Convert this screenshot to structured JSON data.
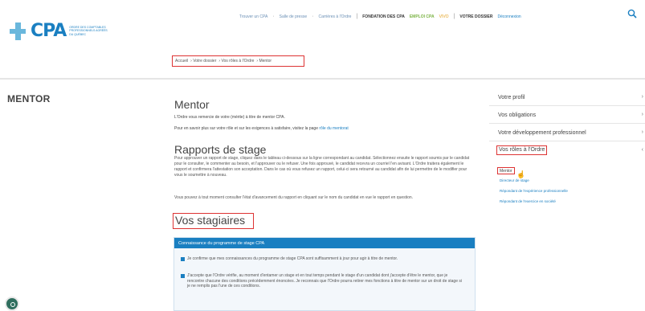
{
  "header": {
    "logo_text": "CPA",
    "logo_sub": "Ordre des comptables professionnels agréés du Québec",
    "nav": [
      "Trouver un CPA",
      "Salle de presse",
      "Carrières à l'Ordre"
    ],
    "foundation": "FONDATION DES CPA",
    "emploi": "EMPLOI CPA",
    "vivo": "VIVO",
    "dossier": "VOTRE DOSSIER",
    "deconnexion": "Déconnexion"
  },
  "breadcrumb": [
    "Accueil",
    "Votre dossier",
    "Vos rôles à l'Ordre",
    "Mentor"
  ],
  "side_title": "MENTOR",
  "main": {
    "title": "Mentor",
    "intro": "L'Ordre vous remercie de votre (mérite) à titre de mentor CPA.",
    "info_prefix": "Pour en savoir plus sur votre rôle et sur les exigences à satisfaire, visitez la page ",
    "info_link": "rôle du mentorat",
    "rapports_title": "Rapports de stage",
    "rapports_text": "Pour approuver un rapport de stage, cliquez dans le tableau ci-dessous sur la ligne correspondant au candidat. Sélectionnez ensuite le rapport soumis par le candidat pour le consulter, le commenter au besoin, et l'approuver ou le refuser. Une fois approuvé, le candidat recevra un courriel l'en avisant. L'Ordre traitera également le rapport et confirmera l'attestation son acceptation. Dans le cas où vous refusez un rapport, celui-ci sera retourné au candidat afin de lui permettre de le modifier pour vous le soumettre à nouveau.",
    "rapports_text2": "Vous pouvez à tout moment consulter l'état d'avancement du rapport en cliquant sur le nom du candidat en vue le rapport en question.",
    "stagiaires_title": "Vos stagiaires",
    "panel_title": "Connaissance du programme de stage CPA",
    "check1": "Je confirme que mes connaissances du programme de stage CPA sont suffisamment à jour pour agir à titre de mentor.",
    "check2": "J'accepte que l'Ordre vérifie, au moment d'entamer un stage et en tout temps pendant le stage d'un candidat dont j'accepte d'être le mentor, que je rencontre chacune des conditions précédemment énoncées. Je reconnais que l'Ordre pourra retirer mes fonctions à titre de mentor sur un droit de stage si je ne remplis pas l'une de ces conditions."
  },
  "sidebar": {
    "items": [
      "Votre profil",
      "Vos obligations",
      "Votre développement professionnel"
    ],
    "selected": "Vos rôles à l'Ordre",
    "sub_selected": "Mentor",
    "sub_links": [
      "Directeur de stage",
      "Répondant de l'expérience professionnelle",
      "Répondant de l'exercice en société"
    ]
  }
}
